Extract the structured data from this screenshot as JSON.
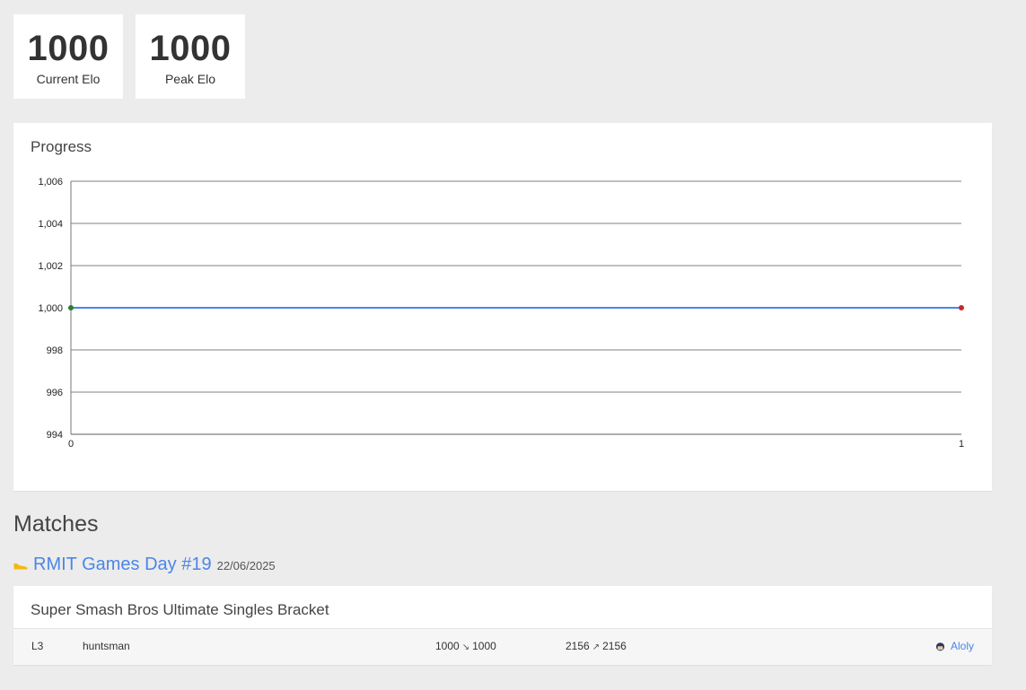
{
  "stats": [
    {
      "value": "1000",
      "label": "Current Elo"
    },
    {
      "value": "1000",
      "label": "Peak Elo"
    }
  ],
  "progress": {
    "title": "Progress"
  },
  "chart_data": {
    "type": "line",
    "title": "",
    "xlabel": "",
    "ylabel": "",
    "x": [
      0,
      1
    ],
    "series": [
      {
        "values": [
          1000,
          1000
        ],
        "color": "#4a86e8"
      }
    ],
    "xlim": [
      0,
      1
    ],
    "ylim": [
      994,
      1006
    ],
    "x_ticks": [
      "0",
      "1"
    ],
    "y_ticks": [
      "994",
      "996",
      "998",
      "1,000",
      "1,002",
      "1,004",
      "1,006"
    ],
    "grid": true,
    "start_marker_color": "#2e7d32",
    "end_marker_color": "#c62828"
  },
  "matches": {
    "heading": "Matches",
    "tournaments": [
      {
        "name": "RMIT Games Day #19",
        "date": "22/06/2025",
        "icon": "sneaker-icon",
        "icon_color": "#f2b90d",
        "events": [
          {
            "title": "Super Smash Bros Ultimate Singles Bracket",
            "matches": [
              {
                "round": "L3",
                "opponent": "huntsman",
                "elo_before": "1000",
                "elo_arrow": "↘",
                "elo_after": "1000",
                "opp_elo_before": "2156",
                "opp_elo_arrow": "↗",
                "opp_elo_after": "2156",
                "character": "Aloly",
                "character_icon": "fighter-head-icon"
              }
            ]
          }
        ]
      }
    ]
  }
}
